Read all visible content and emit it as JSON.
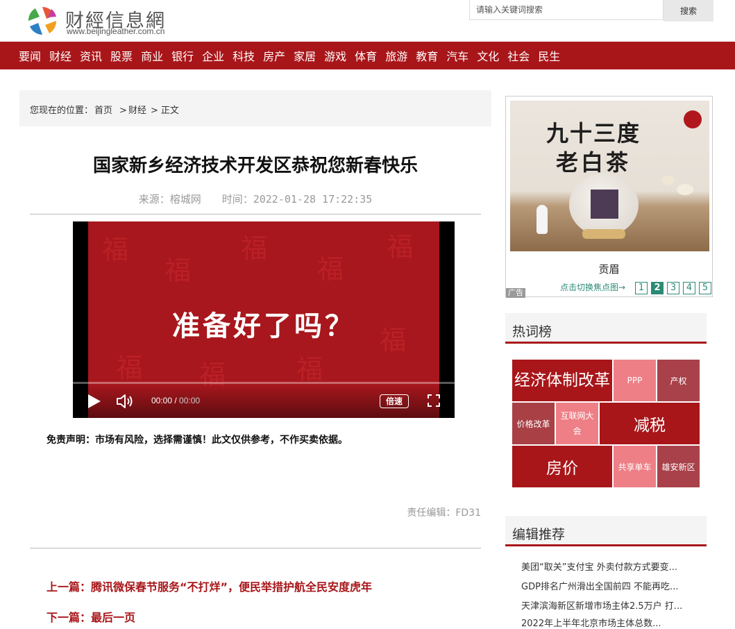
{
  "header": {
    "logo_title": "财經信息網",
    "logo_url": "www.beijingleather.com.cn",
    "search_placeholder": "请输入关键词搜索",
    "search_button": "搜索"
  },
  "nav": {
    "items": [
      "要闻",
      "财经",
      "资讯",
      "股票",
      "商业",
      "银行",
      "企业",
      "科技",
      "房产",
      "家居",
      "游戏",
      "体育",
      "旅游",
      "教育",
      "汽车",
      "文化",
      "社会",
      "民生"
    ]
  },
  "breadcrumb": {
    "prefix": "您现在的位置：",
    "home": "首页",
    "category": "财经",
    "current": "正文",
    "sep": ">"
  },
  "article": {
    "title": "国家新乡经济技术开发区恭祝您新春快乐",
    "source": "来源：榕城网",
    "time": "时间：2022-01-28 17:22:35",
    "video_caption": "准备好了吗？",
    "video_current_time": "00:00",
    "video_total_time": "00:00",
    "video_speed_label": "倍速",
    "video_progress_percent": 0,
    "disclaimer": "免责声明：市场有风险，选择需谨慎！此文仅供参考，不作买卖依据。",
    "editor": "责任编辑：FD31",
    "prev": "上一篇：腾讯微保春节服务“不打烊”，便民举措护航全民安度虎年",
    "next": "下一篇：最后一页"
  },
  "ad": {
    "headline_line1": "九十三度",
    "headline_line2": "老白茶",
    "caption": "贡眉",
    "tag": "广告",
    "switch_label": "点击切换焦点图→",
    "pages": [
      "1",
      "2",
      "3",
      "4",
      "5"
    ],
    "active_page": 2
  },
  "hot_words": {
    "title": "热词榜",
    "tiles": [
      {
        "text": "经济体制改革",
        "color": "#a8161a"
      },
      {
        "text": "PPP",
        "color": "#ee7f87"
      },
      {
        "text": "产权",
        "color": "#a8414a"
      },
      {
        "text": "价格改革",
        "color": "#a84046"
      },
      {
        "text": "互联网大会",
        "color": "#ee7f87"
      },
      {
        "text": "减税",
        "color": "#a8161a"
      },
      {
        "text": "房价",
        "color": "#a8161a"
      },
      {
        "text": "共享单车",
        "color": "#ee7f87"
      },
      {
        "text": "雄安新区",
        "color": "#a8414a"
      }
    ]
  },
  "recommend": {
    "title": "编辑推荐",
    "items": [
      "美团“取关”支付宝 外卖付款方式要变...",
      "GDP排名广州滑出全国前四 不能再吃...",
      "天津滨海新区新增市场主体2.5万户 打...",
      "2022年上半年北京市场主体总数..."
    ]
  },
  "colors": {
    "brand_red": "#a8161a",
    "accent_teal": "#2b8a76"
  }
}
